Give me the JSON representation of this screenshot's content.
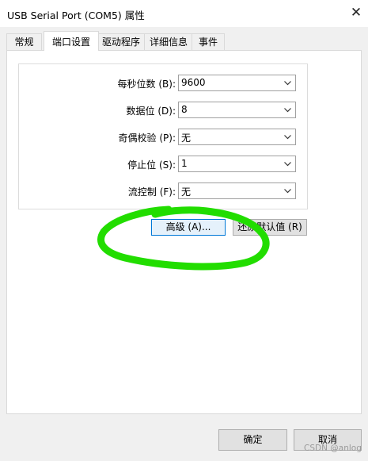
{
  "window": {
    "title": "USB Serial Port (COM5) 属性",
    "close_glyph": "✕"
  },
  "tabs": [
    {
      "label": "常规"
    },
    {
      "label": "端口设置"
    },
    {
      "label": "驱动程序"
    },
    {
      "label": "详细信息"
    },
    {
      "label": "事件"
    }
  ],
  "settings": [
    {
      "label": "每秒位数 (B):",
      "value": "9600"
    },
    {
      "label": "数据位 (D):",
      "value": "8"
    },
    {
      "label": "奇偶校验 (P):",
      "value": "无"
    },
    {
      "label": "停止位 (S):",
      "value": "1"
    },
    {
      "label": "流控制 (F):",
      "value": "无"
    }
  ],
  "buttons": {
    "advanced": "高级 (A)...",
    "restore_defaults": "还原默认值 (R)",
    "ok": "确定",
    "cancel": "取消"
  },
  "watermark": "CSDN @anlog",
  "annotation_color": "#22dd00"
}
